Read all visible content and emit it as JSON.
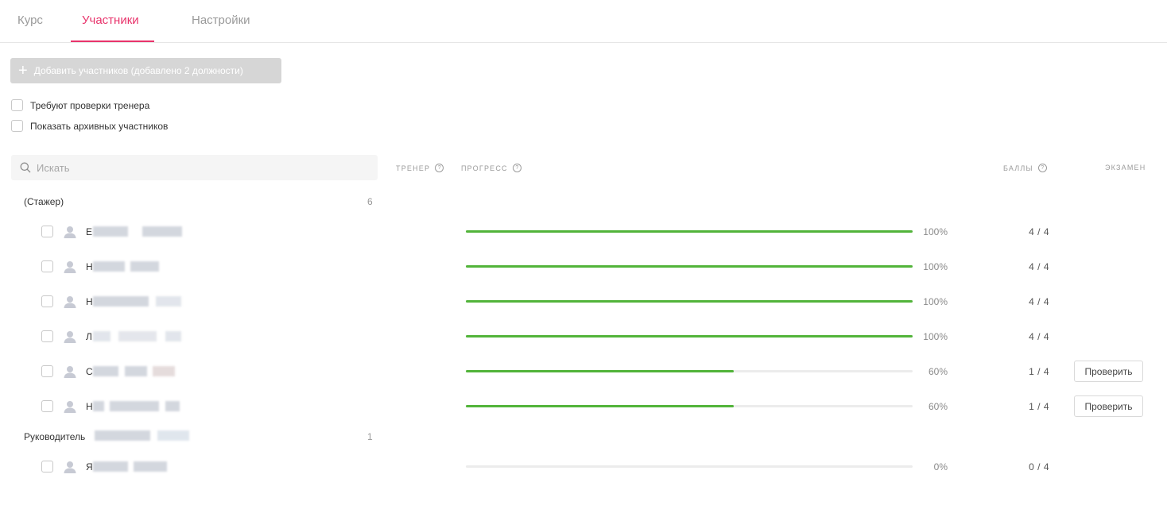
{
  "tabs": [
    {
      "label": "Курс",
      "active": false
    },
    {
      "label": "Участники",
      "active": true
    },
    {
      "label": "Настройки",
      "active": false
    }
  ],
  "add_button": {
    "icon": "plus-icon",
    "label": "Добавить участников (добавлено 2 должности)",
    "disabled": true
  },
  "filters": [
    {
      "label": "Требуют проверки тренера",
      "checked": false
    },
    {
      "label": "Показать архивных участников",
      "checked": false
    }
  ],
  "search": {
    "placeholder": "Искать",
    "value": "",
    "icon": "search-icon"
  },
  "columns": {
    "trainer": "ТРЕНЕР",
    "progress": "ПРОГРЕСС",
    "score": "БАЛЛЫ",
    "exam": "ЭКЗАМЕН",
    "help_icon": "question-circle-icon"
  },
  "groups": [
    {
      "name": "(Стажер)",
      "count": "6",
      "members": [
        {
          "name_initial": "Е",
          "progress": 100,
          "progress_label": "100%",
          "score": "4 / 4",
          "action": ""
        },
        {
          "name_initial": "Н",
          "progress": 100,
          "progress_label": "100%",
          "score": "4 / 4",
          "action": ""
        },
        {
          "name_initial": "Н",
          "progress": 100,
          "progress_label": "100%",
          "score": "4 / 4",
          "action": ""
        },
        {
          "name_initial": "Л",
          "progress": 100,
          "progress_label": "100%",
          "score": "4 / 4",
          "action": ""
        },
        {
          "name_initial": "С",
          "progress": 60,
          "progress_label": "60%",
          "score": "1 / 4",
          "action": "Проверить"
        },
        {
          "name_initial": "Н",
          "progress": 60,
          "progress_label": "60%",
          "score": "1 / 4",
          "action": "Проверить"
        }
      ]
    },
    {
      "name": "Руководитель",
      "count": "1",
      "members": [
        {
          "name_initial": "Я",
          "progress": 0,
          "progress_label": "0%",
          "score": "0 / 4",
          "action": ""
        }
      ]
    }
  ],
  "colors": {
    "accent": "#e8336b",
    "progress_fill": "#52b43a",
    "progress_track": "#ececec"
  }
}
